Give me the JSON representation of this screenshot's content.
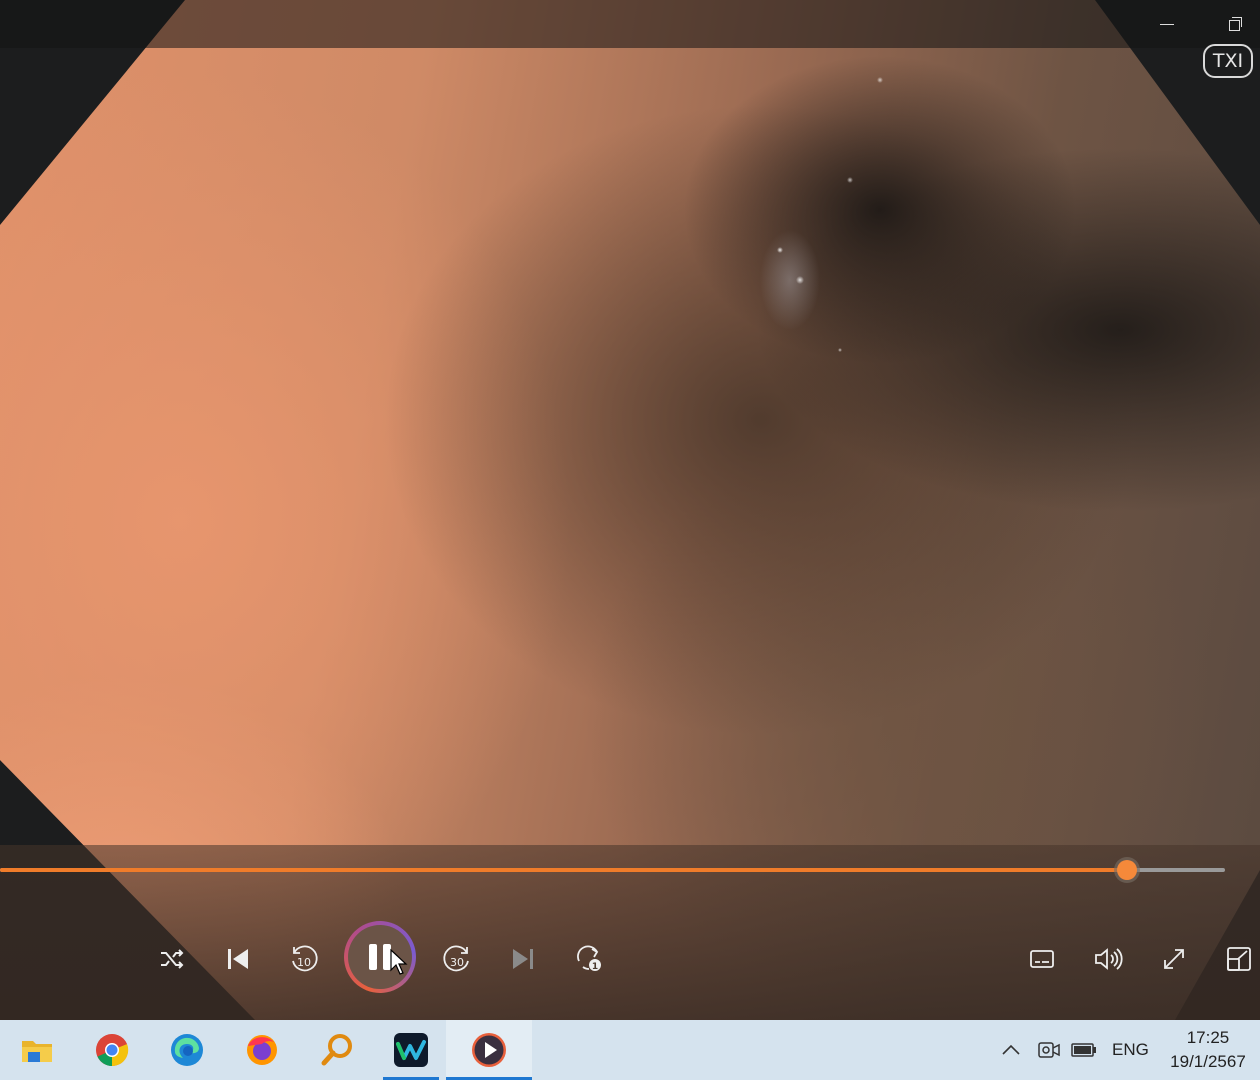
{
  "window": {
    "minimize_label": "minimize",
    "restore_label": "restore",
    "overlay_badge": "TXI"
  },
  "player": {
    "progress_fraction": 0.92,
    "controls": [
      {
        "icon": "shuffle-icon"
      },
      {
        "icon": "previous-icon"
      },
      {
        "icon": "rewind-10-icon",
        "text": "10"
      },
      {
        "icon": "pause-icon"
      },
      {
        "icon": "forward-30-icon",
        "text": "30"
      },
      {
        "icon": "next-icon"
      },
      {
        "icon": "repeat-one-icon",
        "text": "1"
      },
      {
        "icon": "subtitles-icon"
      },
      {
        "icon": "volume-icon"
      },
      {
        "icon": "fullscreen-icon"
      },
      {
        "icon": "mini-player-icon"
      }
    ],
    "accent_color": "#f07c2a"
  },
  "taskbar": {
    "apps": [
      {
        "icon": "file-explorer-icon"
      },
      {
        "icon": "chrome-icon"
      },
      {
        "icon": "edge-icon"
      },
      {
        "icon": "firefox-icon"
      },
      {
        "icon": "search-app-icon"
      },
      {
        "icon": "webex-icon",
        "active": true
      },
      {
        "icon": "media-player-icon",
        "active": true,
        "current": true
      }
    ],
    "tray": {
      "language": "ENG",
      "time": "17:25",
      "date": "19/1/2567"
    }
  }
}
